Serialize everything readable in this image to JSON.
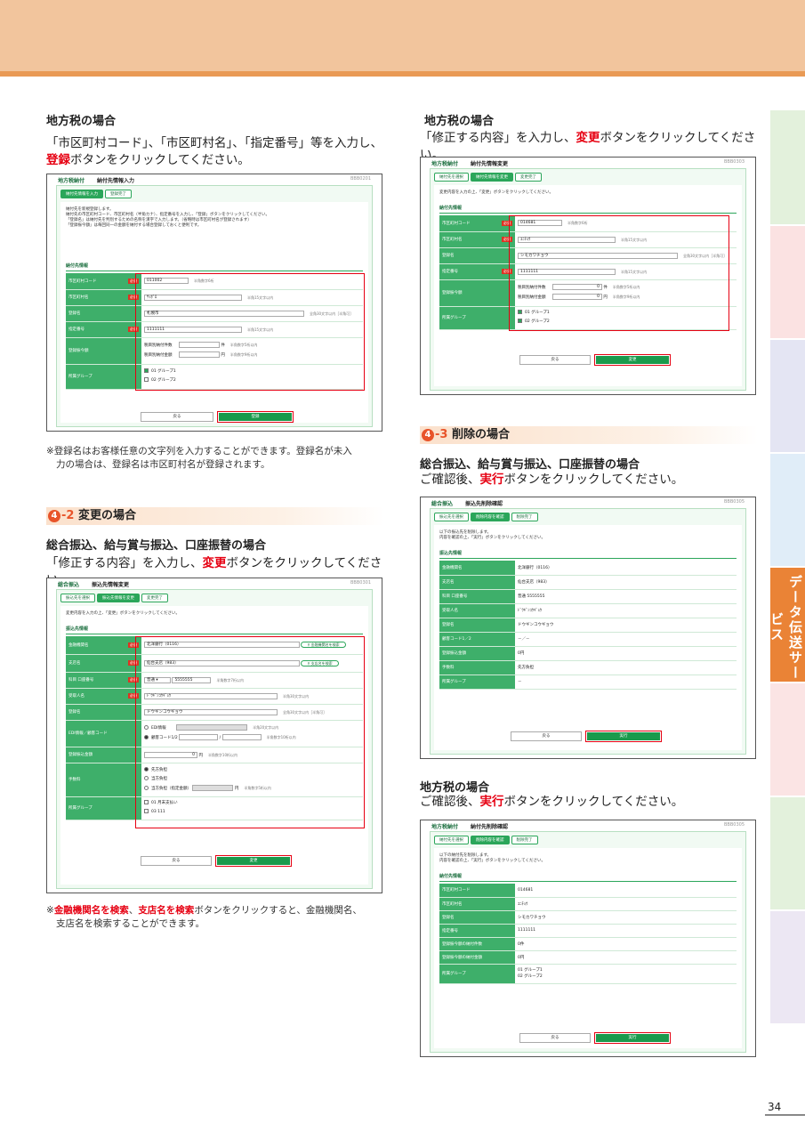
{
  "side_tab": {
    "label": "データ伝送サービス"
  },
  "page_number": "34",
  "left": {
    "local_tax_heading": "地方税の場合",
    "local_tax_instr_1": "「市区町村コード」、「市区町村名」、「指定番号」等を入力し、",
    "local_tax_instr_2_red": "登録",
    "local_tax_instr_2_rest": "ボタンをクリックしてください。",
    "note_1": "※登録名はお客様任意の文字列を入力することができます。登録名が未入",
    "note_2": "力の場合は、登録名は市区町村名が登録されます。",
    "sec_num": "4",
    "sec_dash": "-2",
    "sec_title": "変更の場合",
    "sogo_heading": "総合振込、給与賞与振込、口座振替の場合",
    "change_instr_a": "「修正する内容」を入力し、",
    "change_instr_red": "変更",
    "change_instr_b": "ボタンをクリックしてください。",
    "note2_mark": "※",
    "note2_red1": "金融機関名を検索",
    "note2_sep": "、",
    "note2_red2": "支店名を検索",
    "note2_rest": "ボタンをクリックすると、金融機関名、",
    "note2_line2": "支店名を検索することができます。"
  },
  "right": {
    "local_tax_heading": "地方税の場合",
    "change_instr_a": "「修正する内容」を入力し、",
    "change_instr_red": "変更",
    "change_instr_b": "ボタンをクリックしてください。",
    "sec_num": "4",
    "sec_dash": "-3",
    "sec_title": "削除の場合",
    "sogo_heading": "総合振込、給与賞与振込、口座振替の場合",
    "del_instr_a": "ご確認後、",
    "del_instr_red": "実行",
    "del_instr_b": "ボタンをクリックしてください。",
    "local_tax_heading_2": "地方税の場合",
    "del_instr2_a": "ご確認後、",
    "del_instr2_red": "実行",
    "del_instr2_b": "ボタンをクリックしてください。"
  },
  "shot1": {
    "app": "地方税納付",
    "screen": "納付先情報入力",
    "id": "BBB0201",
    "steps": [
      "納付先情報を入力",
      "登録完了"
    ],
    "lead": "納付先を新規登録します。\n納付先の市区町村コード、市区町村名（半角カナ）、指定番号を入力し、「登録」ボタンをクリックしてください。\n「登録名」は納付先を判別するための名称を漢字で入力します。（省略時は市区町村名が登録されます）\n「登録振今額」は毎回同一の金額を納付する場合登録しておくと便利です。",
    "sub": "納付先情報",
    "rows": [
      {
        "label": "市区町村コード",
        "req": "必須",
        "value": "011002",
        "hint": "半角数字6桁"
      },
      {
        "label": "市区町村名",
        "req": "必須",
        "value": "ｻｯﾎﾟﾛ",
        "hint": "半角15文字以内"
      },
      {
        "label": "登録名",
        "req": "",
        "value": "札幌市",
        "hint": "全角30文字以内［半角可］"
      },
      {
        "label": "指定番号",
        "req": "必須",
        "value": "1111111",
        "hint": "半角15文字以内"
      },
      {
        "label": "登録振今額",
        "req": "",
        "line1": "税目別納付件数",
        "line1_unit": "件",
        "line1_hint": "半角数字5桁以内",
        "line2": "税目別納付金額",
        "line2_unit": "円",
        "line2_hint": "半角数字9桁以内"
      },
      {
        "label": "所属グループ",
        "req": "",
        "opt1": "01 グループ1",
        "opt2": "02 グループ2"
      }
    ],
    "back": "戻る",
    "go": "登録"
  },
  "shot2": {
    "app": "総合振込",
    "screen": "振込先情報変更",
    "id": "BBB0301",
    "steps": [
      "振込先を選択",
      "振込先情報を変更",
      "変更完了"
    ],
    "lead": "変更内容を入力の上、「変更」ボタンをクリックしてください。",
    "sub": "振込先情報",
    "rows": [
      {
        "label": "金融機関名",
        "req": "必須",
        "value": "北洋銀行（0116）",
        "btn": "金融機関名を検索"
      },
      {
        "label": "支店名",
        "req": "必須",
        "value": "仙台支店（983）",
        "btn": "支店名を検索"
      },
      {
        "label": "科目 口座番号",
        "req": "必須",
        "sel": "普通",
        "value": "5555555",
        "hint": "半角数字7桁以内"
      },
      {
        "label": "受取人名",
        "req": "必須",
        "value": "ﾄﾞｳｷﾞﾝｺｳｷﾞｮｳ",
        "hint": "半角30文字以内"
      },
      {
        "label": "登録名",
        "req": "",
        "value": "ドウギンコウギョウ",
        "hint": "全角30文字以内［半角可］"
      },
      {
        "label": "EDI情報／顧客コード",
        "req": "",
        "opt1": "EDI情報",
        "opt1_hint": "半角20文字以内",
        "opt2": "顧客コード1/2",
        "opt2_hint": "半角数字10桁以内"
      },
      {
        "label": "登録振込金額",
        "req": "",
        "value": "0",
        "unit": "円",
        "hint": "半角数字10桁以内"
      },
      {
        "label": "手数料",
        "req": "",
        "opt1": "先方負担",
        "opt2": "当方負担",
        "opt3": "当方負担（指定金額）",
        "opt3_unit": "円",
        "opt3_hint": "半角数字5桁以内"
      },
      {
        "label": "所属グループ",
        "req": "",
        "opt1": "01 月末支払い",
        "opt2": "03 111"
      }
    ],
    "back": "戻る",
    "go": "変更"
  },
  "shot3": {
    "app": "地方税納付",
    "screen": "納付先情報変更",
    "id": "BBB0303",
    "steps": [
      "納付先を選択",
      "納付先情報を変更",
      "変更完了"
    ],
    "lead": "変更内容を入力の上、「変更」ボタンをクリックしてください。",
    "sub": "納付先情報",
    "rows": [
      {
        "label": "市区町村コード",
        "req": "必須",
        "value": "014681",
        "hint": "半角数字6桁"
      },
      {
        "label": "市区町村名",
        "req": "必須",
        "value": "ﾕﾆﾁｮｳ",
        "hint": "半角15文字以内"
      },
      {
        "label": "登録名",
        "req": "",
        "value": "シモカワチョウ",
        "hint": "全角30文字以内［半角可］"
      },
      {
        "label": "指定番号",
        "req": "必須",
        "value": "1111111",
        "hint": "半角15文字以内"
      },
      {
        "label": "登録振今額",
        "req": "",
        "line1": "税目別納付件数",
        "line1_val": "0",
        "line1_unit": "件",
        "line1_hint": "半角数字5桁以内",
        "line2": "税目別納付金額",
        "line2_val": "0",
        "line2_unit": "円",
        "line2_hint": "半角数字9桁以内"
      },
      {
        "label": "所属グループ",
        "req": "",
        "opt1": "01 グループ1",
        "opt2": "02 グループ2"
      }
    ],
    "back": "戻る",
    "go": "変更"
  },
  "shot4": {
    "app": "総合振込",
    "screen": "振込先削除確認",
    "id": "BBB0305",
    "steps": [
      "振込先を選択",
      "削除内容を確認",
      "削除完了"
    ],
    "lead": "以下の振込先を削除します。\n内容を確認の上、「実行」ボタンをクリックしてください。",
    "sub": "振込先情報",
    "rows": [
      {
        "label": "金融機関名",
        "value": "北洋銀行（0116）"
      },
      {
        "label": "支店名",
        "value": "仙台支店（983）"
      },
      {
        "label": "科目 口座番号",
        "value": "普通 5555555"
      },
      {
        "label": "受取人名",
        "value": "ﾄﾞｳｷﾞﾝｺｳｷﾞｮｳ"
      },
      {
        "label": "登録名",
        "value": "ドウギンコウギョウ"
      },
      {
        "label": "顧客コード1／2",
        "value": "－／－"
      },
      {
        "label": "登録振込金額",
        "value": "0円"
      },
      {
        "label": "手数料",
        "value": "先方負担"
      },
      {
        "label": "所属グループ",
        "value": "－"
      }
    ],
    "back": "戻る",
    "go": "実行"
  },
  "shot5": {
    "app": "地方税納付",
    "screen": "納付先削除確認",
    "id": "BBB0305",
    "steps": [
      "納付先を選択",
      "削除内容を確認",
      "削除完了"
    ],
    "lead": "以下の納付先を削除します。\n内容を確認の上、「実行」ボタンをクリックしてください。",
    "sub": "納付先情報",
    "rows": [
      {
        "label": "市区町村コード",
        "value": "014681"
      },
      {
        "label": "市区町村名",
        "value": "ﾕﾆﾁｮｳ"
      },
      {
        "label": "登録名",
        "value": "シモカワチョウ"
      },
      {
        "label": "指定番号",
        "value": "1111111"
      },
      {
        "label": "登録振今額の納付件数",
        "value": "0件"
      },
      {
        "label": "登録振今額の納付金額",
        "value": "0円"
      },
      {
        "label": "所属グループ",
        "value": "01 グループ1",
        "value2": "02 グループ2"
      }
    ],
    "back": "戻る",
    "go": "実行"
  },
  "colors": {
    "accent_orange": "#ea8336",
    "band": "#f2c59d",
    "green": "#2ba65a",
    "red": "#e60012"
  }
}
